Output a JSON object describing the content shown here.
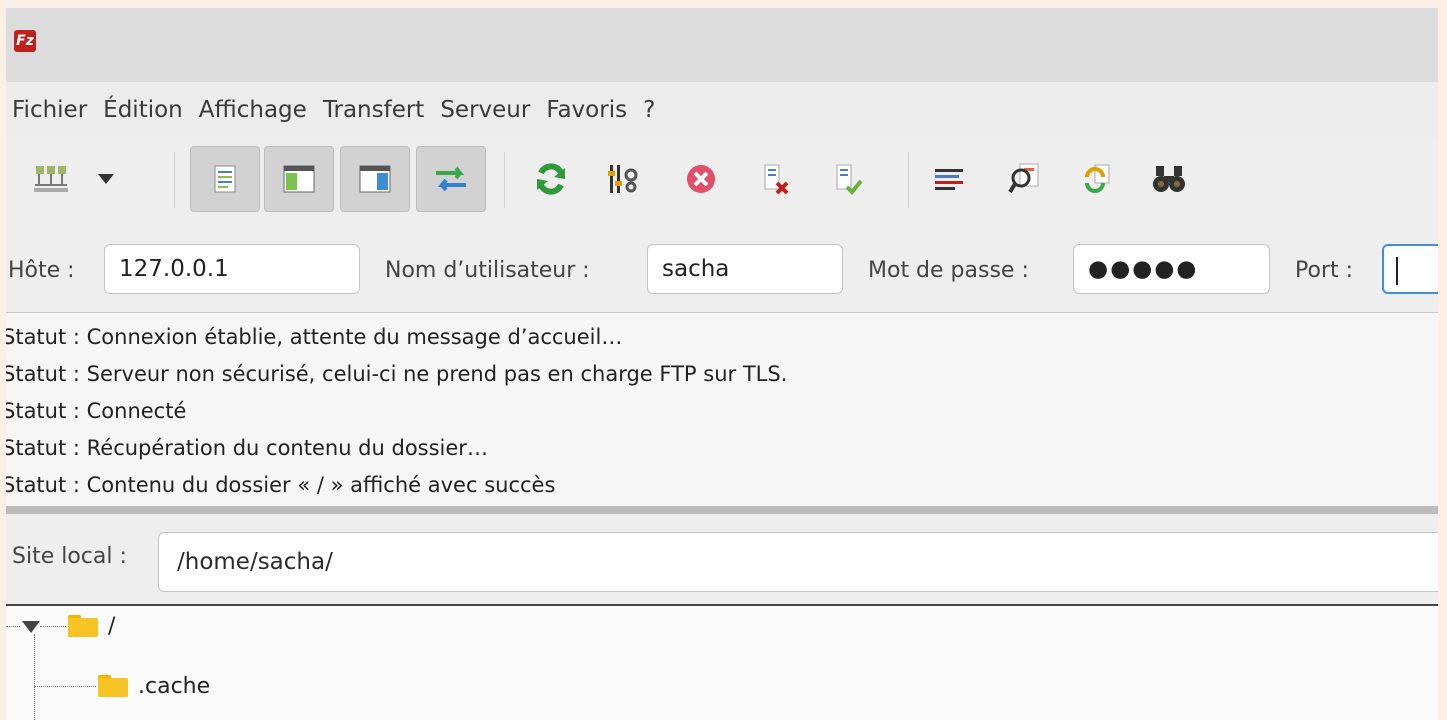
{
  "app": {
    "logo_text": "Fz"
  },
  "menu": [
    "Fichier",
    "Édition",
    "Affichage",
    "Transfert",
    "Serveur",
    "Favoris",
    "?"
  ],
  "toolbar": {
    "icons": [
      "site-manager-icon",
      "dropdown-arrow-icon",
      "message-log-toggle-icon",
      "local-tree-toggle-icon",
      "remote-tree-toggle-icon",
      "transfer-queue-toggle-icon",
      "refresh-icon",
      "filter-settings-icon",
      "cancel-icon",
      "disconnect-icon",
      "reconnect-icon",
      "directory-listing-filters-icon",
      "compare-directories-icon",
      "synchronized-browsing-icon",
      "search-files-icon"
    ]
  },
  "quickconnect": {
    "host_label": "Hôte :",
    "host_value": "127.0.0.1",
    "user_label": "Nom d’utilisateur :",
    "user_value": "sacha",
    "password_label": "Mot de passe :",
    "password_value": "●●●●●",
    "port_label": "Port :",
    "port_value": ""
  },
  "log": [
    "Statut : Connexion établie, attente du message d’accueil…",
    "Statut : Serveur non sécurisé, celui-ci ne prend pas en charge FTP sur TLS.",
    "Statut : Connecté",
    "Statut : Récupération du contenu du dossier…",
    "Statut : Contenu du dossier « / » affiché avec succès"
  ],
  "local_site": {
    "label": "Site local :",
    "path": "/home/sacha/"
  },
  "tree": [
    {
      "name": "/"
    },
    {
      "name": ".cache"
    }
  ],
  "colors": {
    "accent_focus": "#3d8fd6",
    "folder": "#f7c325",
    "logo": "#c0201c"
  }
}
